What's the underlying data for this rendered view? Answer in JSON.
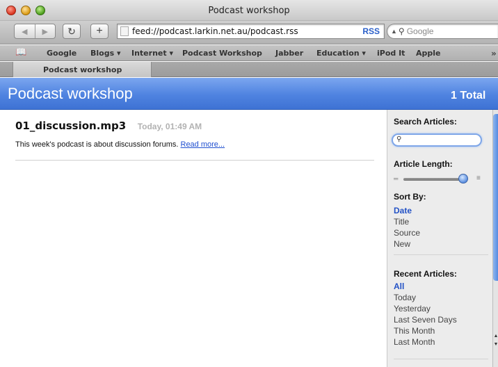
{
  "window": {
    "title": "Podcast workshop"
  },
  "toolbar": {
    "url": "feed://podcast.larkin.net.au/podcast.rss",
    "rss_label": "RSS",
    "search_placeholder": "Google"
  },
  "bookmarks": [
    "Google",
    "Blogs ▾",
    "Internet ▾",
    "Podcast Workshop",
    "Jabber",
    "Education ▾",
    "iPod It",
    "Apple"
  ],
  "tabs": [
    {
      "label": "Podcast workshop"
    }
  ],
  "feed": {
    "title": "Podcast workshop",
    "total": "1 Total"
  },
  "articles": [
    {
      "title": "01_discussion.mp3",
      "date": "Today, 01:49 AM",
      "summary": "This week's podcast is about discussion forums.",
      "read_more": "Read more..."
    }
  ],
  "sidebar": {
    "search_heading": "Search Articles:",
    "length_heading": "Article Length:",
    "article_length_fraction": 0.95,
    "sort_heading": "Sort By:",
    "sort_options": [
      "Date",
      "Title",
      "Source",
      "New"
    ],
    "sort_selected": "Date",
    "recent_heading": "Recent Articles:",
    "recent_options": [
      "All",
      "Today",
      "Yesterday",
      "Last Seven Days",
      "This Month",
      "Last Month"
    ],
    "recent_selected": "All"
  },
  "colors": {
    "header_blue": "#4f83e0",
    "link_blue": "#1f4fd0",
    "selected_blue": "#2352c6"
  }
}
